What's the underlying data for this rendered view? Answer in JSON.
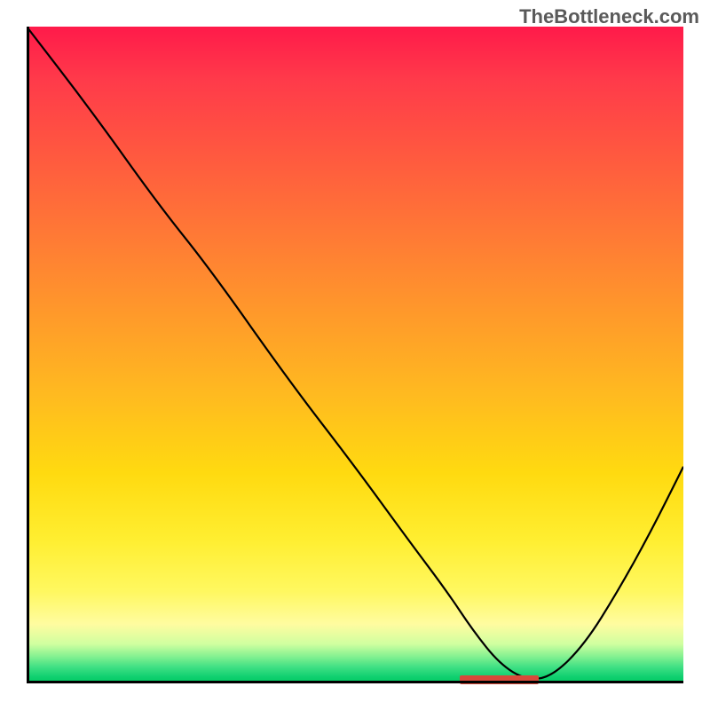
{
  "watermark": "TheBottleneck.com",
  "chart_data": {
    "type": "line",
    "title": "",
    "xlabel": "",
    "ylabel": "",
    "xlim": [
      0,
      100
    ],
    "ylim": [
      0,
      100
    ],
    "x": [
      0,
      10,
      20,
      28,
      40,
      50,
      58,
      64,
      68,
      72,
      76,
      80,
      85,
      90,
      95,
      100
    ],
    "values": [
      100,
      87,
      73,
      63,
      46,
      33,
      22,
      14,
      8,
      3,
      0.5,
      1,
      6,
      14,
      23,
      33
    ],
    "marker": {
      "x_start": 66,
      "x_end": 78,
      "y": 0.5
    },
    "background": "vertical-gradient red→yellow→green"
  }
}
